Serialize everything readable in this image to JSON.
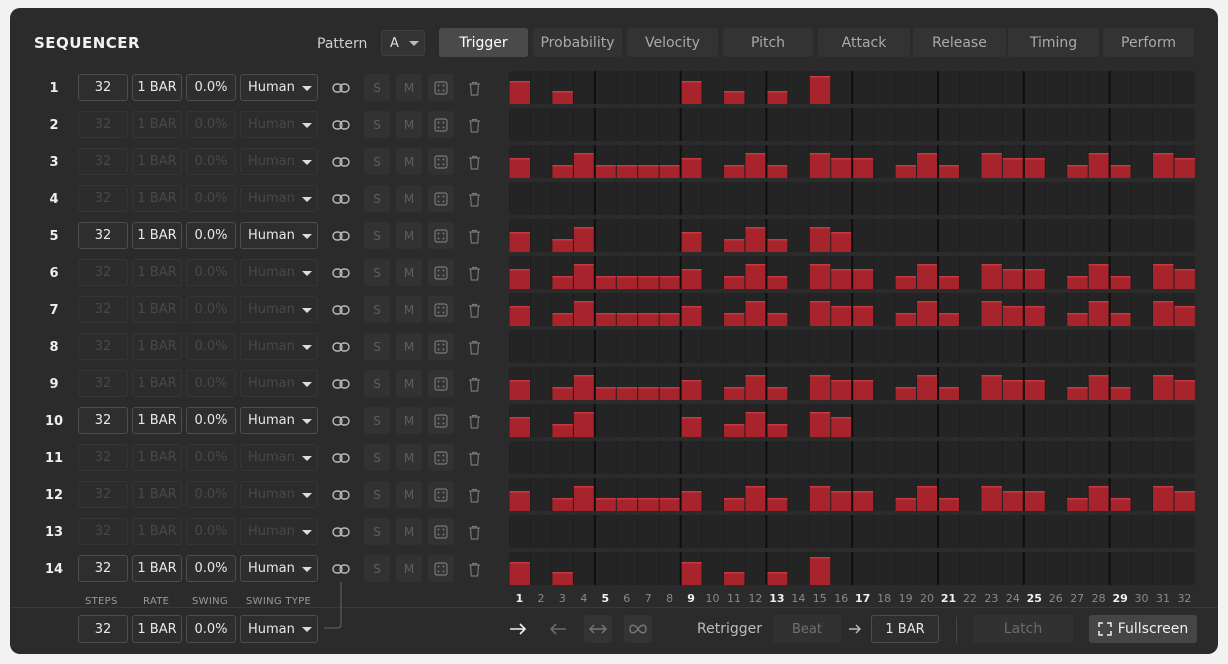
{
  "app": {
    "title": "SEQUENCER"
  },
  "pattern": {
    "label": "Pattern",
    "value": "A"
  },
  "tabs": [
    {
      "label": "Trigger",
      "active": true
    },
    {
      "label": "Probability"
    },
    {
      "label": "Velocity"
    },
    {
      "label": "Pitch"
    },
    {
      "label": "Attack"
    },
    {
      "label": "Release"
    },
    {
      "label": "Timing"
    },
    {
      "label": "Perform"
    }
  ],
  "tracks": [
    {
      "num": "1",
      "active": true,
      "steps": "32",
      "rate": "1 BAR",
      "swing": "0.0%",
      "swing_type": "Human",
      "pattern": "p1"
    },
    {
      "num": "2",
      "active": false,
      "steps": "32",
      "rate": "1 BAR",
      "swing": "0.0%",
      "swing_type": "Human",
      "pattern": "none"
    },
    {
      "num": "3",
      "active": false,
      "steps": "32",
      "rate": "1 BAR",
      "swing": "0.0%",
      "swing_type": "Human",
      "pattern": "full"
    },
    {
      "num": "4",
      "active": false,
      "steps": "32",
      "rate": "1 BAR",
      "swing": "0.0%",
      "swing_type": "Human",
      "pattern": "none"
    },
    {
      "num": "5",
      "active": true,
      "steps": "32",
      "rate": "1 BAR",
      "swing": "0.0%",
      "swing_type": "Human",
      "pattern": "p5"
    },
    {
      "num": "6",
      "active": false,
      "steps": "32",
      "rate": "1 BAR",
      "swing": "0.0%",
      "swing_type": "Human",
      "pattern": "full"
    },
    {
      "num": "7",
      "active": false,
      "steps": "32",
      "rate": "1 BAR",
      "swing": "0.0%",
      "swing_type": "Human",
      "pattern": "full"
    },
    {
      "num": "8",
      "active": false,
      "steps": "32",
      "rate": "1 BAR",
      "swing": "0.0%",
      "swing_type": "Human",
      "pattern": "none"
    },
    {
      "num": "9",
      "active": false,
      "steps": "32",
      "rate": "1 BAR",
      "swing": "0.0%",
      "swing_type": "Human",
      "pattern": "full"
    },
    {
      "num": "10",
      "active": true,
      "steps": "32",
      "rate": "1 BAR",
      "swing": "0.0%",
      "swing_type": "Human",
      "pattern": "p5"
    },
    {
      "num": "11",
      "active": false,
      "steps": "32",
      "rate": "1 BAR",
      "swing": "0.0%",
      "swing_type": "Human",
      "pattern": "none"
    },
    {
      "num": "12",
      "active": false,
      "steps": "32",
      "rate": "1 BAR",
      "swing": "0.0%",
      "swing_type": "Human",
      "pattern": "full"
    },
    {
      "num": "13",
      "active": false,
      "steps": "32",
      "rate": "1 BAR",
      "swing": "0.0%",
      "swing_type": "Human",
      "pattern": "none"
    },
    {
      "num": "14",
      "active": true,
      "steps": "32",
      "rate": "1 BAR",
      "swing": "0.0%",
      "swing_type": "Human",
      "pattern": "p1"
    }
  ],
  "patterns": {
    "p1": [
      0.7,
      0,
      0.4,
      0,
      0,
      0,
      0,
      0,
      0.7,
      0,
      0.4,
      0,
      0.4,
      0,
      0.85,
      0,
      0,
      0,
      0,
      0,
      0,
      0,
      0,
      0,
      0,
      0,
      0,
      0,
      0,
      0,
      0,
      0
    ],
    "p5": [
      0.6,
      0,
      0.4,
      0.75,
      0,
      0,
      0,
      0,
      0.6,
      0,
      0.4,
      0.75,
      0.4,
      0,
      0.75,
      0.6,
      0,
      0,
      0,
      0,
      0,
      0,
      0,
      0,
      0,
      0,
      0,
      0,
      0,
      0,
      0,
      0
    ],
    "full": [
      0.6,
      0,
      0.4,
      0.75,
      0.4,
      0.4,
      0.4,
      0.4,
      0.6,
      0,
      0.4,
      0.75,
      0.4,
      0,
      0.75,
      0.6,
      0.6,
      0,
      0.4,
      0.75,
      0.4,
      0,
      0.75,
      0.6,
      0.6,
      0,
      0.4,
      0.75,
      0.4,
      0,
      0.75,
      0.6
    ],
    "none": [
      0,
      0,
      0,
      0,
      0,
      0,
      0,
      0,
      0,
      0,
      0,
      0,
      0,
      0,
      0,
      0,
      0,
      0,
      0,
      0,
      0,
      0,
      0,
      0,
      0,
      0,
      0,
      0,
      0,
      0,
      0,
      0
    ]
  },
  "row_controls": {
    "solo": "S",
    "mute": "M"
  },
  "columns": {
    "steps": "STEPS",
    "rate": "RATE",
    "swing": "SWING",
    "swing_type": "SWING TYPE"
  },
  "step_numbers": [
    "1",
    "2",
    "3",
    "4",
    "5",
    "6",
    "7",
    "8",
    "9",
    "10",
    "11",
    "12",
    "13",
    "14",
    "15",
    "16",
    "17",
    "18",
    "19",
    "20",
    "21",
    "22",
    "23",
    "24",
    "25",
    "26",
    "27",
    "28",
    "29",
    "30",
    "31",
    "32"
  ],
  "global": {
    "steps": "32",
    "rate": "1 BAR",
    "swing": "0.0%",
    "swing_type": "Human"
  },
  "transport": {
    "retrigger_label": "Retrigger",
    "retrigger_mode": "Beat",
    "retrigger_rate": "1 BAR",
    "latch": "Latch",
    "fullscreen": "Fullscreen"
  },
  "colors": {
    "step_on": "#a8242c",
    "step_off": "#1e1e1e",
    "accent_tab": "#4a4a4a"
  }
}
